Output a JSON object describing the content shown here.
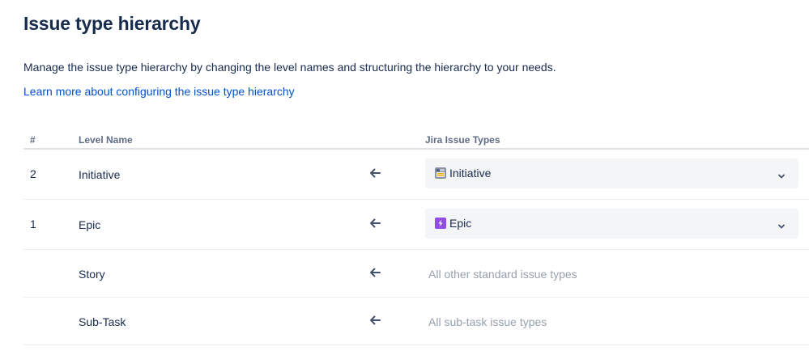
{
  "page": {
    "title": "Issue type hierarchy",
    "description": "Manage the issue type hierarchy by changing the level names and structuring the hierarchy to your needs.",
    "learn_more_link": "Learn more about configuring the issue type hierarchy"
  },
  "table": {
    "headers": {
      "number": "#",
      "level_name": "Level Name",
      "jira_issue_types": "Jira Issue Types"
    },
    "rows": [
      {
        "number": "2",
        "level_name": "Initiative",
        "issue_type": "Initiative",
        "issue_type_icon": "initiative-icon",
        "has_select": true
      },
      {
        "number": "1",
        "level_name": "Epic",
        "issue_type": "Epic",
        "issue_type_icon": "epic-icon",
        "has_select": true
      },
      {
        "number": "",
        "level_name": "Story",
        "issue_type": "All other standard issue types",
        "has_select": false
      },
      {
        "number": "",
        "level_name": "Sub-Task",
        "issue_type": "All sub-task issue types",
        "has_select": false
      }
    ]
  },
  "colors": {
    "link": "#0052cc",
    "text": "#172b4d",
    "muted": "#97a0af",
    "select_bg": "#f4f5f7",
    "epic_purple": "#904ee2",
    "initiative_gray": "#8993a4"
  }
}
